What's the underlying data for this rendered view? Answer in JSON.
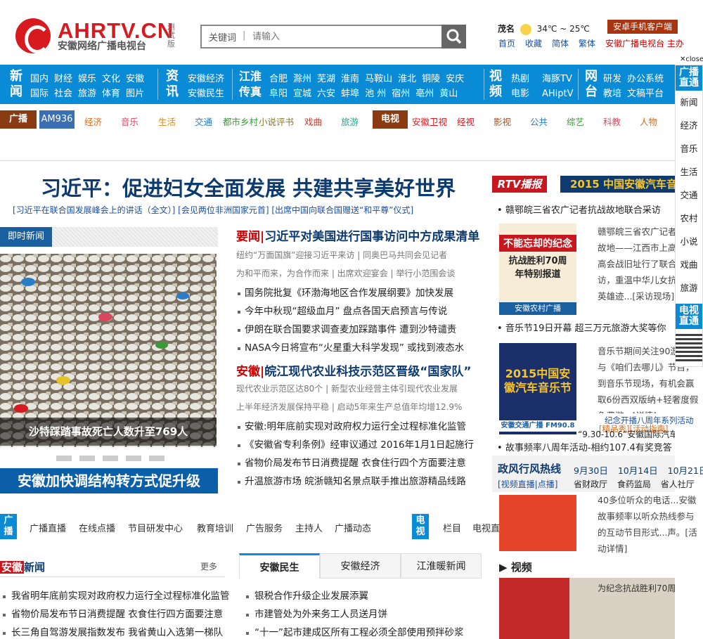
{
  "brand": {
    "name": "AHRTV.CN",
    "subtitle": "安徽网络广播电视台",
    "test": "测试版"
  },
  "search": {
    "keyword_label": "关键词",
    "placeholder": "请输入"
  },
  "weather": {
    "city": "茂名",
    "temp": "34℃ ~ 25℃"
  },
  "toplinks": [
    "首页",
    "收藏",
    "简体",
    "繁体",
    "安徽广播电视台 主办"
  ],
  "app_button": "安卓手机客户端",
  "close_label": "close",
  "nav": {
    "news": {
      "title": "新闻",
      "row1": [
        "国内",
        "财经",
        "娱乐",
        "文化",
        "安徽"
      ],
      "row2": [
        "国际",
        "社会",
        "旅游",
        "体育",
        "图片"
      ]
    },
    "info": {
      "title": "资讯",
      "row1": [
        "安徽经济"
      ],
      "row2": [
        "安徽民生"
      ]
    },
    "jh": {
      "title": "江淮传真",
      "row1": [
        "合肥",
        "滁州",
        "芜湖",
        "淮南",
        "马鞍山",
        "淮北",
        "铜陵",
        "安庆"
      ],
      "row2": [
        "阜阳",
        "宣城",
        "六安",
        "蚌埠",
        "池 州",
        "宿州",
        "亳州",
        "黄山"
      ]
    },
    "video": {
      "title": "视频",
      "row1": [
        "热剧",
        "海豚TV"
      ],
      "row2": [
        "电影",
        "AHiptV"
      ]
    },
    "net": {
      "title": "网台",
      "row1": [
        "研发",
        "办公系统"
      ],
      "row2": [
        "教培",
        "文稿平台"
      ]
    }
  },
  "subnav": {
    "radio_tag": "广播",
    "am": "AM936",
    "radio_items": [
      "经济",
      "音乐",
      "生活",
      "交通",
      "都市乡村",
      "小说评书",
      "戏曲",
      "旅游"
    ],
    "tv_tag": "电视",
    "tv_items": [
      "安徽卫视",
      "经视",
      "影视",
      "公共",
      "综艺",
      "科教",
      "人物"
    ]
  },
  "headline": "习近平：促进妇女全面发展 共建共享美好世界",
  "headlinks": "[习近平在联合国发展峰会上的讲话（全文）] [会见两位非洲国家元首] [出席中国向联合国赠送“和平尊”仪式]",
  "jsxw": "即时新闻",
  "photo_caption": "沙特踩踏事故死亡人数升至769人",
  "banner": "安徽加快调结构转方式促升级",
  "mid": {
    "h1_tag": "要闻|",
    "h1": "习近平对美国进行国事访问中方成果清单",
    "s1": "纽约“万面国旗”迎接习近平来访 | 同奥巴马共同会见记者",
    "s2": "为和平而来，为合作而来 | 出席欢迎宴会 | 举行小范围会谈",
    "list1": [
      "国务院批复《环渤海地区合作发展纲要》加快发展",
      "今年中秋现“超级血月” 盘点各国天启预言与传说",
      "伊朗在联合国要求调查麦加踩踏事件 遭到沙特谴责",
      "NASA今日将宣布“火星重大科学发现” 或找到液态水"
    ],
    "h2_tag": "安徽|",
    "h2": "皖江现代农业科技示范区晋级“国家队”",
    "s3": "现代农业示范区达80个 | 新型农业经营主体引现代农业发展",
    "s4": "上半年经济发展保持平稳 | 启动5年来生产总值年均增12.9%",
    "list2": [
      "安徽:明年底前实现对政府权力运行全过程标准化监管",
      "《安徽省专利条例》经审议通过 2016年1月1日起施行",
      "省物价局发布节日消费提醒 衣食住行四个方面要注意",
      "升温旅游市场 皖浙赣知名景点联手推出旅游精品线路"
    ]
  },
  "rtv": {
    "tag": "RTV播报",
    "banner": "2015 中国安徽汽车音乐节"
  },
  "right": {
    "i1": "赣鄂皖三省农广记者抗战故地联合采访",
    "t1": "赣鄂皖三省农广记者抗战故地——江西市上高县上高会战旧址行了联合采访，重温中华儿女抗日的英雄迹...[采访现场]",
    "img1_title": "不能忘却的纪念",
    "img1_sub": "抗战胜利70周年特别报道",
    "img1_foot": "安徽农村广播",
    "i2": "音乐节19日开幕 超三万元旅游大奖等你",
    "t2": "音乐节期间关注90游，参与《咱们去哪儿》节目，到音乐节现场，有机会赢取6份西双版纳+轻奢度假免费游...[详情]",
    "img2_title": "2015中国安徽汽车音乐节",
    "img2_foot": "安徽交通广播 FM90.8",
    "overlap1": "纪念开播八周年系列活动",
    "overlap2": "[精品秀][活动指南]",
    "i3": "故事频率八周年活动-相约107.4有奖竞答",
    "i4": "“9.30-10.6”安徽国际汽车展览会",
    "zf_title": "政风行风热线",
    "zf_dates": [
      "9月30日",
      "10月14日",
      "10月21日"
    ],
    "zf_sub": "[视频直播|点播]",
    "zf_units": [
      "省财政厅",
      "食药监局",
      "省人社厅"
    ],
    "t3": "40多位听众的电话...安徽故事频率以听众热线参与的互动节目形式...声。[活动详情]",
    "video_title": "视频",
    "video_caption": "为纪念抗战胜利70周年，"
  },
  "float": {
    "top": "广播直通",
    "items": [
      "新闻",
      "经济",
      "音乐",
      "生活",
      "交通",
      "农村",
      "小说",
      "戏曲",
      "旅游"
    ],
    "bottom": "电视直通"
  },
  "sec2": {
    "tag": "广播",
    "items": [
      "广播直播",
      "在线点播",
      "节目研发中心",
      "教育培训",
      "广告服务",
      "主持人",
      "广播动态"
    ],
    "tv_tag": "电视",
    "tv_items": [
      "栏目",
      "电视直播",
      "海豚TV",
      "IPTV",
      "安徽电视"
    ]
  },
  "ahxw": {
    "title_a": "安徽",
    "title_b": "新闻",
    "more": "更多",
    "items": [
      "我省明年底前实现对政府权力运行全过程标准化监管",
      "省物价局发布节日消费提醒 衣食住行四方面要注意",
      "长三角自驾游发展指数发布 我省黄山入选第一梯队"
    ]
  },
  "tabs": {
    "labels": [
      "安徽民生",
      "安徽经济",
      "江淮暖新闻"
    ],
    "items": [
      "银税合作升级企业发展添翼",
      "市建管处为外来务工人员送月饼",
      "“十一”起市建成区所有工程必须全部使用预拌砂浆"
    ]
  },
  "colors": {
    "nav_blue": "#0a8bd6",
    "brand_red": "#d71920",
    "headline": "#0d3b70"
  }
}
